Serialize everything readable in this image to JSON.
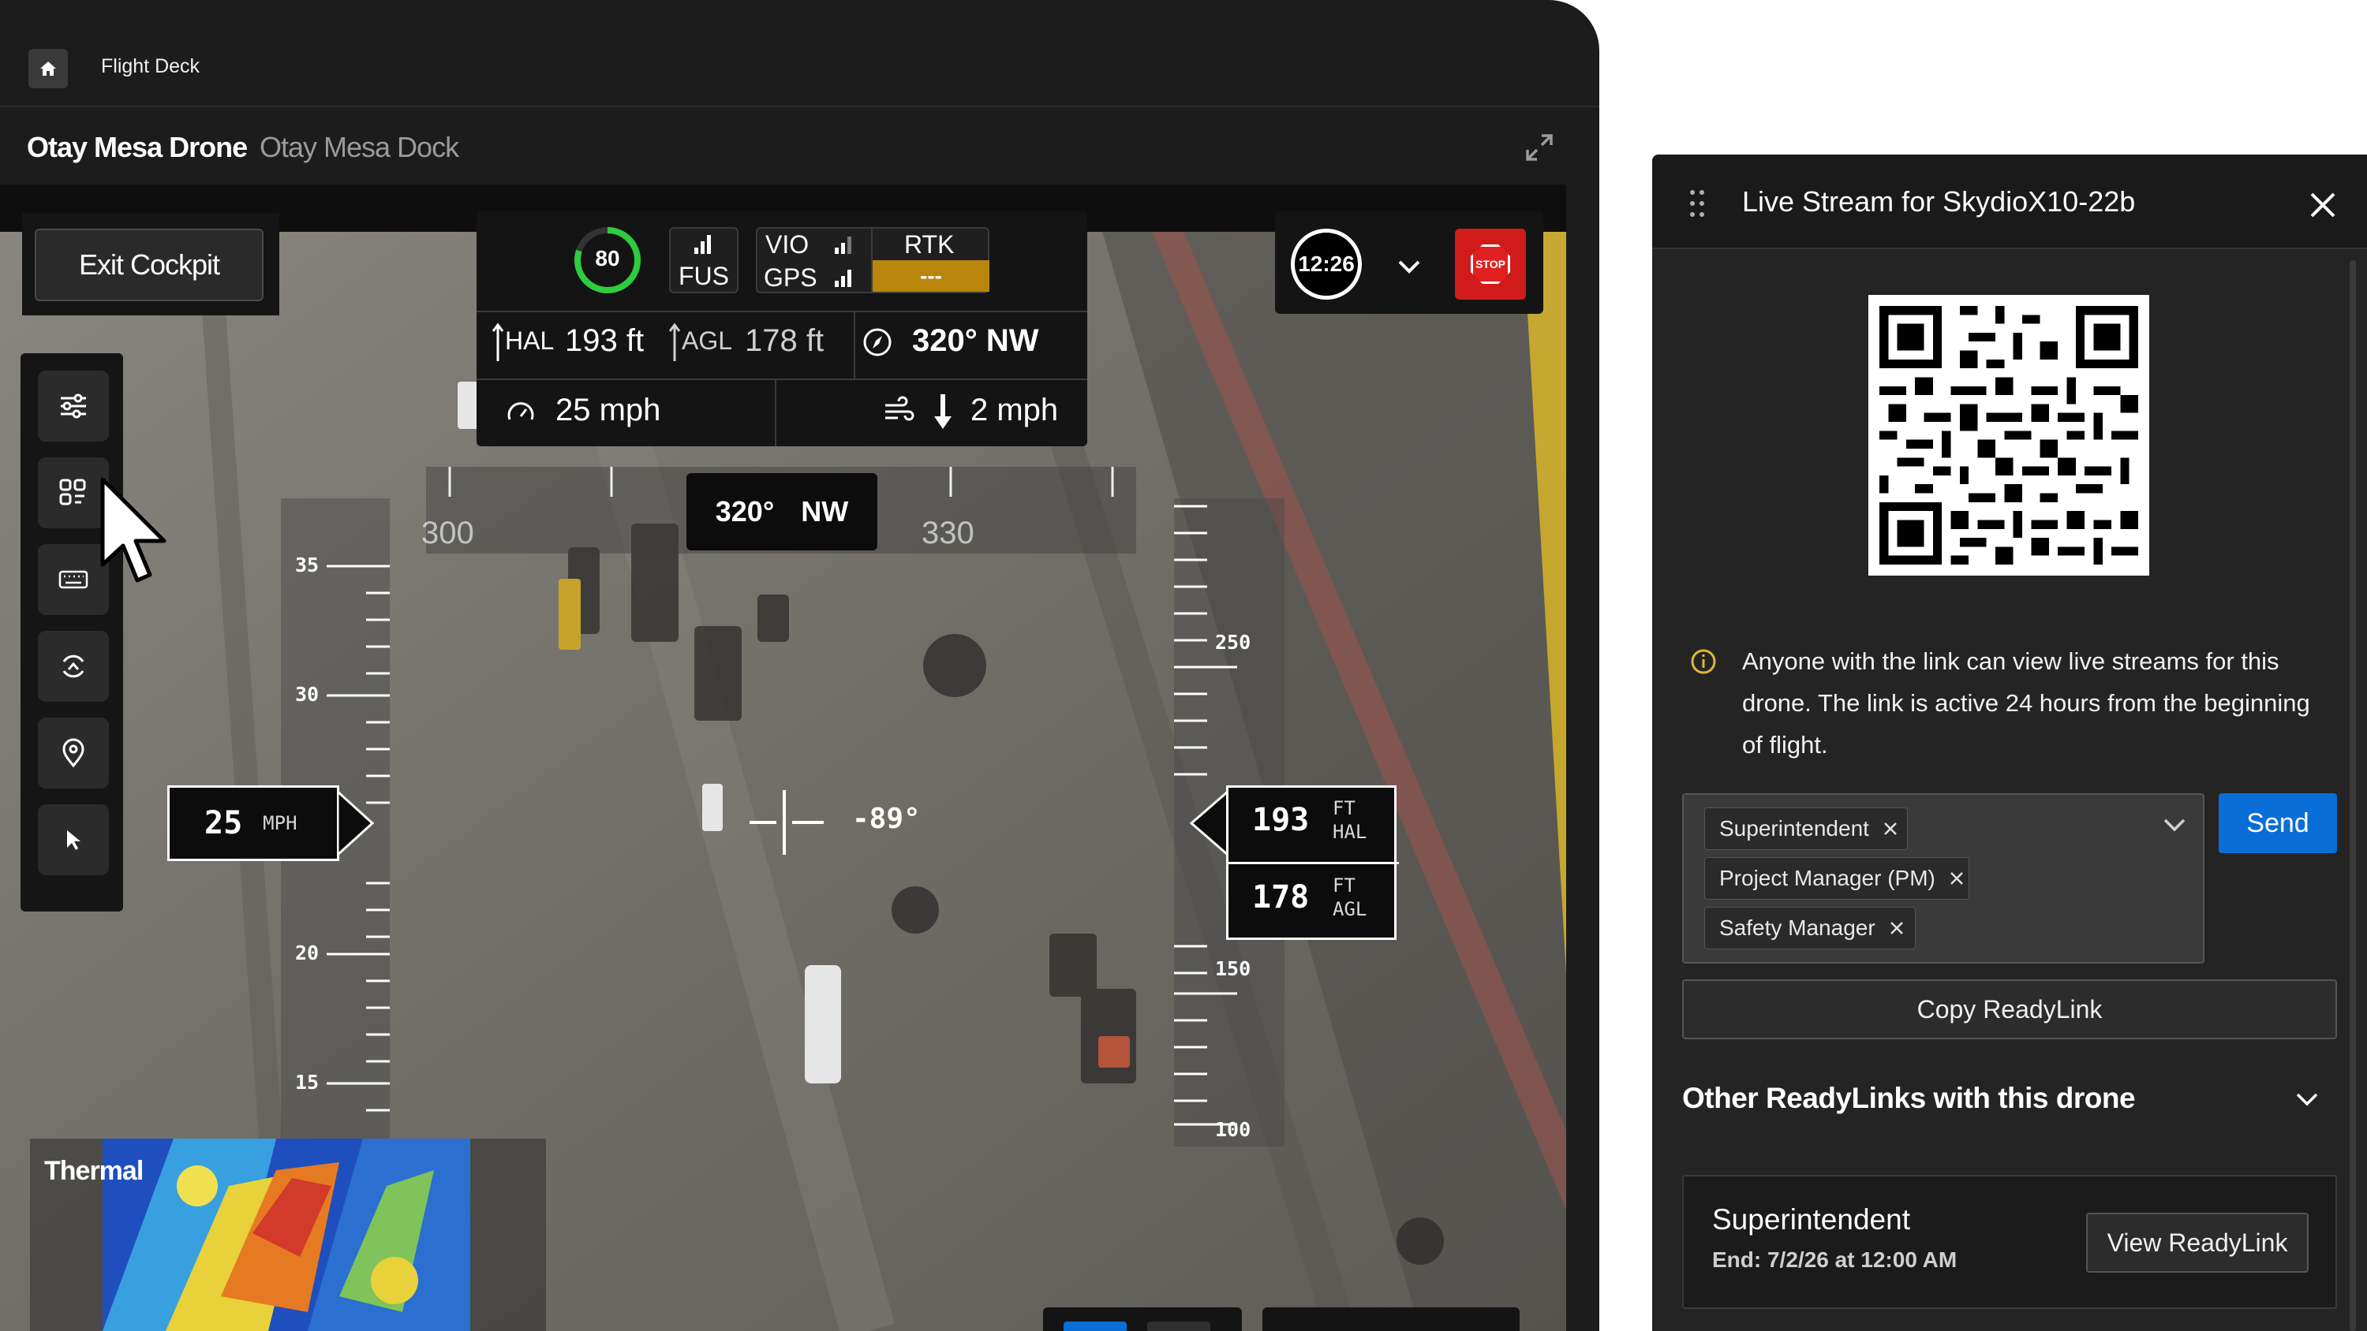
{
  "window": {
    "app_title": "Flight Deck"
  },
  "subheader": {
    "drone_name": "Otay Mesa Drone",
    "dock_name": "Otay Mesa Dock"
  },
  "cockpit": {
    "exit_label": "Exit Cockpit",
    "tools": [
      "sliders-icon",
      "grid-icon",
      "keyboard-icon",
      "orbit-icon",
      "location-pin-icon",
      "pointer-icon"
    ],
    "status": {
      "battery_percent": "80",
      "fus_label": "FUS",
      "vio_label": "VIO",
      "gps_label": "GPS",
      "rtk_label": "RTK",
      "rtk_value": "---",
      "rtk_color": "#b8860b",
      "hal_label": "HAL",
      "hal_value": "193 ft",
      "agl_label": "AGL",
      "agl_value": "178 ft",
      "heading": "320° NW",
      "speed": "25 mph",
      "wind": "2 mph"
    },
    "timer": "12:26",
    "stop_label": "STOP",
    "stop_color": "#d11b1b",
    "heading_tape": {
      "left_tick": "300",
      "right_tick": "330",
      "deg": "320°",
      "dir": "NW"
    },
    "speed_tape": {
      "ticks": [
        "35",
        "30",
        "20",
        "15"
      ],
      "value": "25",
      "unit": "MPH"
    },
    "altitude_tape": {
      "ticks": [
        "250",
        "150",
        "100"
      ],
      "hal_value": "193",
      "hal_unit_1": "FT",
      "hal_unit_2": "HAL",
      "agl_value": "178",
      "agl_unit_1": "FT",
      "agl_unit_2": "AGL"
    },
    "pitch": "-89°",
    "thermal_label": "Thermal"
  },
  "live_stream": {
    "title": "Live Stream for SkydioX10-22b",
    "info_text": "Anyone with the link can view live streams for this drone. The link is active 24 hours from the beginning of flight.",
    "recipients": [
      "Superintendent",
      "Project Manager (PM)",
      "Safety Manager"
    ],
    "send_label": "Send",
    "send_color": "#0a6ed8",
    "copy_label": "Copy ReadyLink",
    "other_title": "Other ReadyLinks with this drone",
    "links": [
      {
        "name": "Superintendent",
        "end": "End: 7/2/26 at 12:00 AM",
        "action": "View ReadyLink"
      }
    ]
  }
}
